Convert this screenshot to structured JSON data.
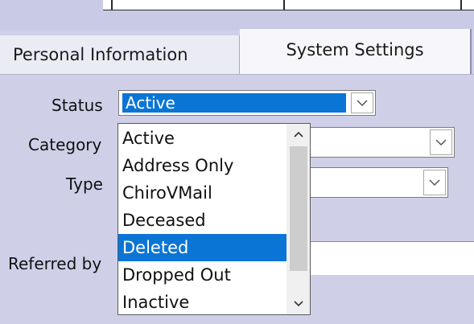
{
  "tabs": {
    "personal_label": "Personal Information",
    "system_label": "System Settings"
  },
  "form": {
    "status_label": "Status",
    "status_value": "Active",
    "category_label": "Category",
    "type_label": "Type",
    "referred_label": "Referred by"
  },
  "dropdown": {
    "items": [
      "Active",
      "Address Only",
      "ChiroVMail",
      "Deceased",
      "Deleted",
      "Dropped Out",
      "Inactive"
    ],
    "highlighted": "Deleted"
  },
  "icons": {
    "chevron_down": "chevron-down-icon",
    "chevron_up": "chevron-up-icon"
  },
  "colors": {
    "selection": "#0b75d5",
    "panel": "#cfd0e8"
  }
}
